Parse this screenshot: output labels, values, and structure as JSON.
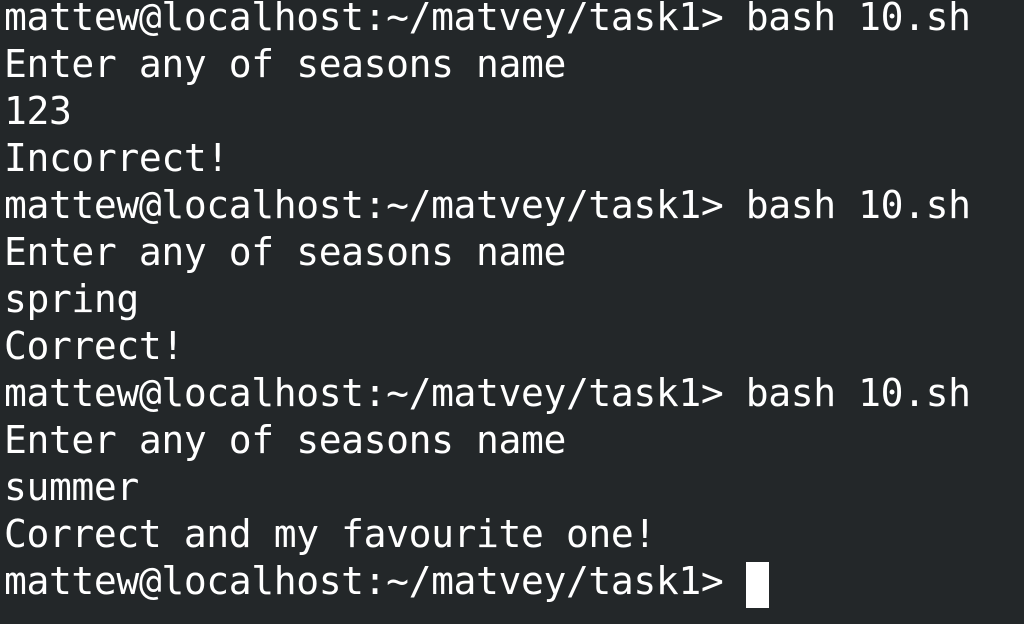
{
  "terminal": {
    "lines": [
      "mattew@localhost:~/matvey/task1> bash 10.sh",
      "Enter any of seasons name",
      "123",
      "Incorrect!",
      "mattew@localhost:~/matvey/task1> bash 10.sh",
      "Enter any of seasons name",
      "spring",
      "Correct!",
      "mattew@localhost:~/matvey/task1> bash 10.sh",
      "Enter any of seasons name",
      "summer",
      "Correct and my favourite one!"
    ],
    "prompt": "mattew@localhost:~/matvey/task1>"
  }
}
